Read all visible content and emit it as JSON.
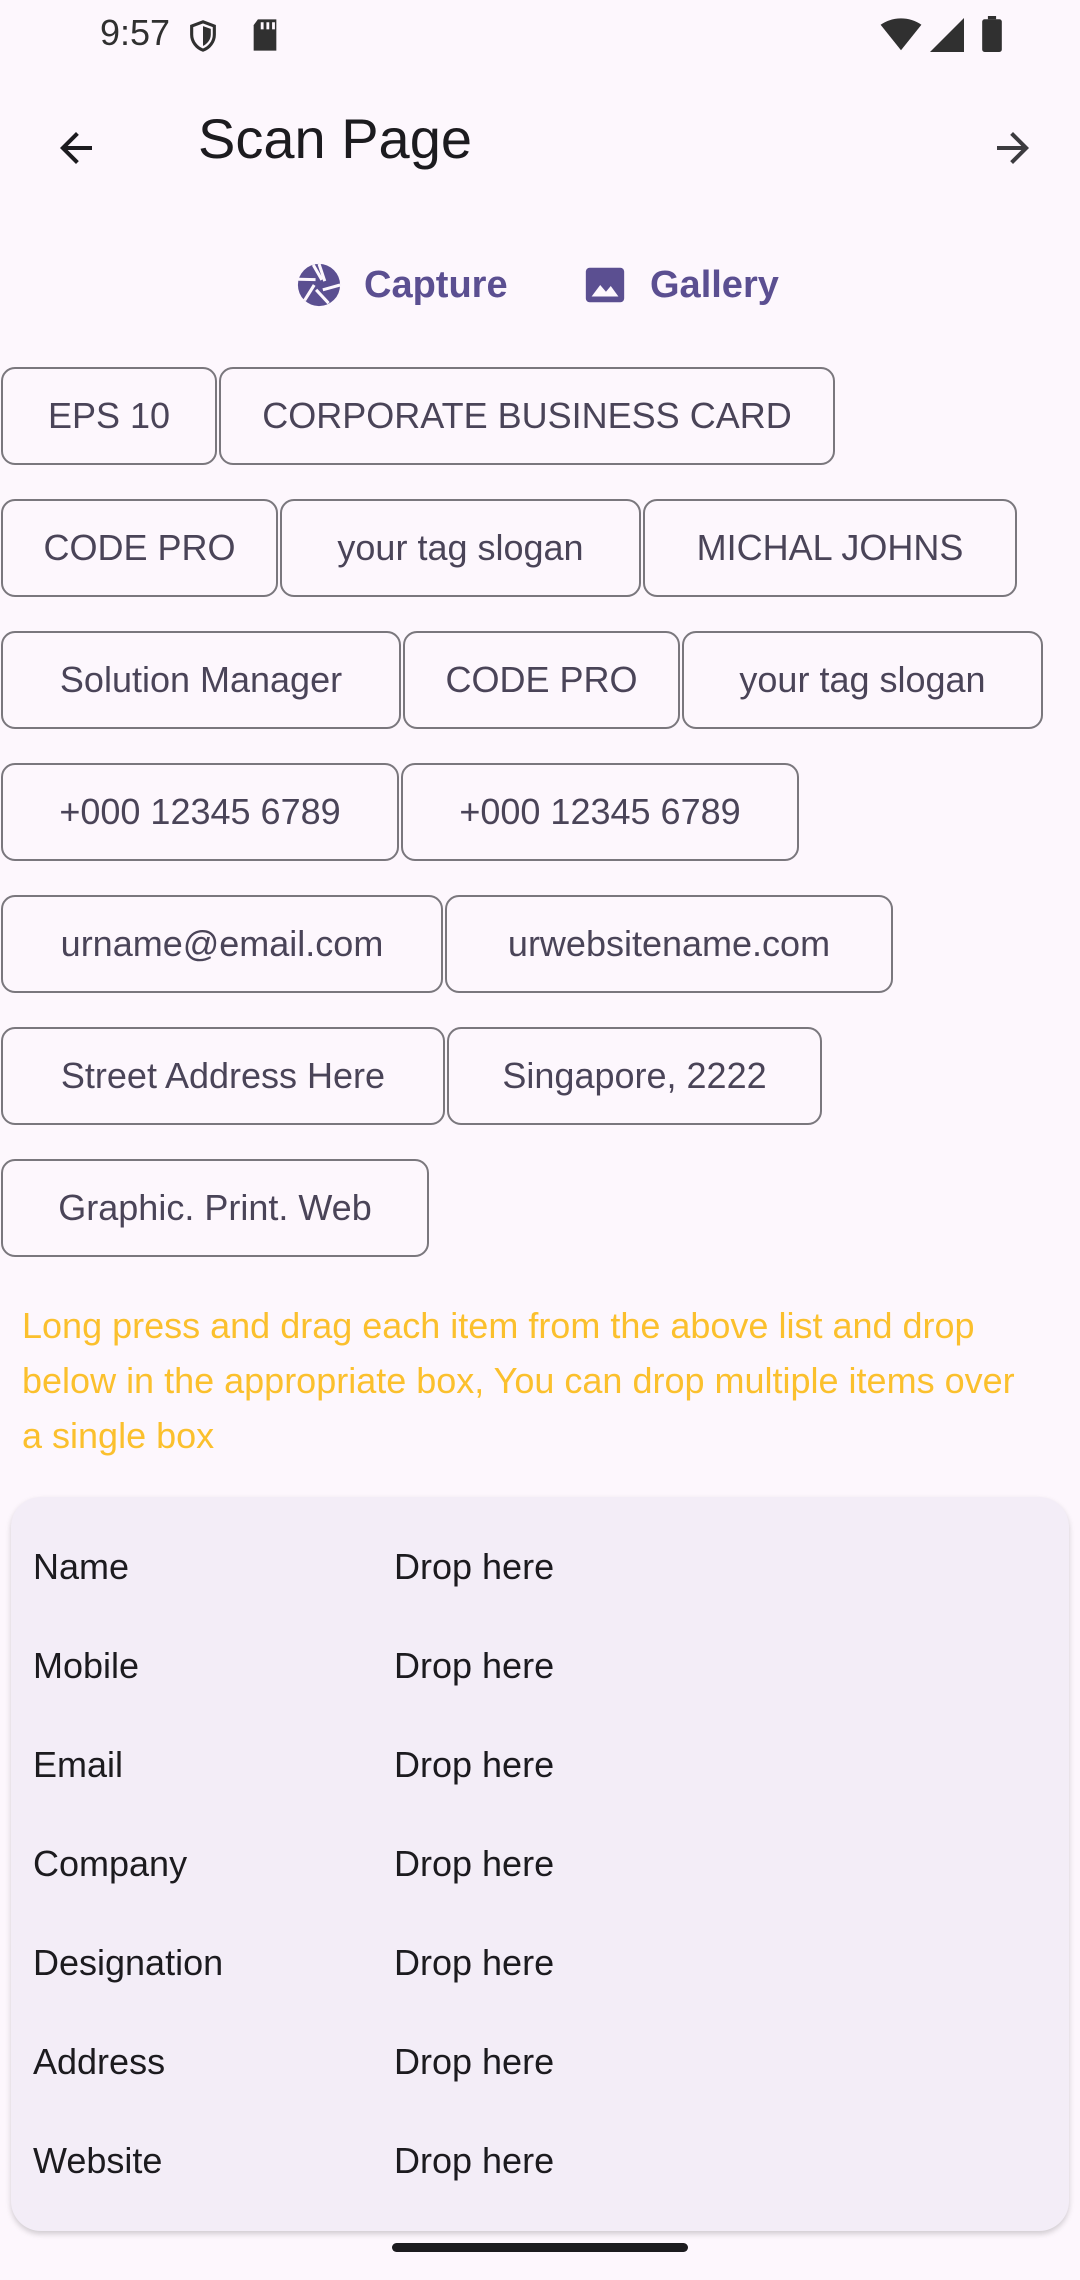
{
  "status_bar": {
    "time": "9:57",
    "icons": [
      "shield-icon",
      "sd-card-icon",
      "wifi-icon",
      "cell-signal-icon",
      "battery-icon"
    ]
  },
  "app_bar": {
    "title": "Scan Page",
    "back_icon": "arrow-back-icon",
    "forward_icon": "arrow-forward-icon"
  },
  "source": {
    "capture_label": "Capture",
    "capture_icon": "camera-shutter-icon",
    "gallery_label": "Gallery",
    "gallery_icon": "image-icon",
    "accent_color": "#5b4f91"
  },
  "chips": [
    [
      "EPS 10",
      "CORPORATE BUSINESS CARD"
    ],
    [
      "CODE PRO",
      "your tag slogan",
      "MICHAL JOHNS"
    ],
    [
      "Solution Manager",
      "CODE PRO",
      "your tag slogan"
    ],
    [
      "+000 12345 6789",
      "+000 12345 6789"
    ],
    [
      "urname@email.com",
      "urwebsitename.com"
    ],
    [
      "Street Address Here",
      "Singapore, 2222"
    ],
    [
      "Graphic. Print. Web"
    ]
  ],
  "hint": {
    "text": "Long press and drag each item from the above list and drop below in the appropriate box, You can drop multiple items over a single box",
    "color": "#fbc02d"
  },
  "fields": [
    {
      "label": "Name",
      "placeholder": "Drop here"
    },
    {
      "label": "Mobile",
      "placeholder": "Drop here"
    },
    {
      "label": "Email",
      "placeholder": "Drop here"
    },
    {
      "label": "Company",
      "placeholder": "Drop here"
    },
    {
      "label": "Designation",
      "placeholder": "Drop here"
    },
    {
      "label": "Address",
      "placeholder": "Drop here"
    },
    {
      "label": "Website",
      "placeholder": "Drop here"
    }
  ]
}
